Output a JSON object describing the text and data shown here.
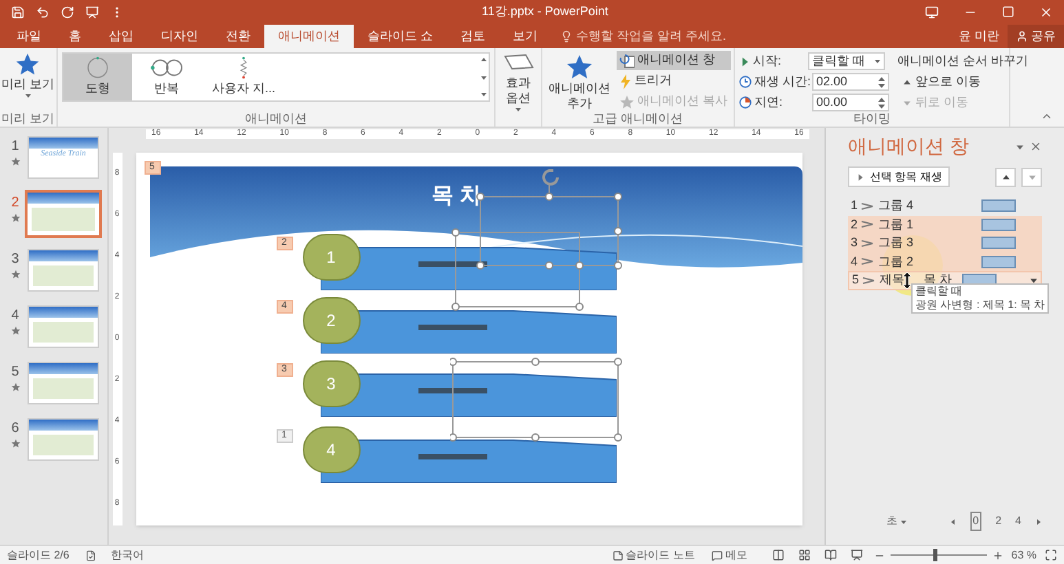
{
  "window": {
    "title": "11강.pptx - PowerPoint"
  },
  "tabs": [
    {
      "label": "파일",
      "selected": false
    },
    {
      "label": "홈",
      "selected": false
    },
    {
      "label": "삽입",
      "selected": false
    },
    {
      "label": "디자인",
      "selected": false
    },
    {
      "label": "전환",
      "selected": false
    },
    {
      "label": "애니메이션",
      "selected": true
    },
    {
      "label": "슬라이드 쇼",
      "selected": false
    },
    {
      "label": "검토",
      "selected": false
    },
    {
      "label": "보기",
      "selected": false
    }
  ],
  "tell_me": {
    "placeholder": "수행할 작업을 알려 주세요."
  },
  "account": {
    "user": "윤 미란",
    "share": "공유"
  },
  "ribbon": {
    "preview": {
      "button": "미리 보기",
      "group": "미리 보기"
    },
    "gallery": {
      "group": "애니메이션",
      "items": [
        {
          "kind": "shape",
          "label": "도형",
          "selected": true
        },
        {
          "kind": "loop",
          "label": "반복",
          "selected": false
        },
        {
          "kind": "custom",
          "label": "사용자 지...",
          "selected": false
        }
      ]
    },
    "effect_options": {
      "label": "효과 옵션"
    },
    "advanced": {
      "add": "애니메이션 추가",
      "group": "고급 애니메이션",
      "buttons": [
        {
          "kind": "pane",
          "label": "애니메이션 창",
          "selected": true,
          "disabled": false
        },
        {
          "kind": "trigger",
          "label": "트리거",
          "selected": false,
          "disabled": false
        },
        {
          "kind": "painter",
          "label": "애니메이션 복사",
          "selected": false,
          "disabled": true
        }
      ]
    },
    "timing": {
      "group": "타이밍",
      "start": {
        "label": "시작:",
        "value": "클릭할 때"
      },
      "duration": {
        "label": "재생 시간:",
        "value": "02.00"
      },
      "delay": {
        "label": "지연:",
        "value": "00.00"
      },
      "reorder": {
        "title": "애니메이션 순서 바꾸기",
        "earlier": {
          "label": "앞으로 이동",
          "disabled": false
        },
        "later": {
          "label": "뒤로 이동",
          "disabled": true
        }
      }
    }
  },
  "slides": [
    {
      "number": "1",
      "selected": false,
      "title": "Seaside Train"
    },
    {
      "number": "2",
      "selected": true
    },
    {
      "number": "3",
      "selected": false
    },
    {
      "number": "4",
      "selected": false
    },
    {
      "number": "5",
      "selected": false
    },
    {
      "number": "6",
      "selected": false
    }
  ],
  "rulers": {
    "horizontal": [
      "16",
      "14",
      "12",
      "10",
      "8",
      "6",
      "4",
      "2",
      "0",
      "2",
      "4",
      "6",
      "8",
      "10",
      "12",
      "14",
      "16"
    ],
    "vertical": [
      "8",
      "6",
      "4",
      "2",
      "0",
      "2",
      "4",
      "6",
      "8"
    ]
  },
  "slide": {
    "title": "목 차",
    "title_tag": {
      "label": "5",
      "selected": true
    },
    "items": [
      {
        "number": "1",
        "tag": {
          "label": "2",
          "selected": true
        }
      },
      {
        "number": "2",
        "tag": {
          "label": "4",
          "selected": true
        }
      },
      {
        "number": "3",
        "tag": {
          "label": "3",
          "selected": true
        }
      },
      {
        "number": "4",
        "tag": {
          "label": "1",
          "selected": false
        }
      }
    ]
  },
  "pane": {
    "title": "애니메이션 창",
    "play": "선택 항목 재생",
    "items": [
      {
        "number": "1",
        "name": "그룹 4",
        "selected": false
      },
      {
        "number": "2",
        "name": "그룹 1",
        "selected": true
      },
      {
        "number": "3",
        "name": "그룹 3",
        "selected": true
      },
      {
        "number": "4",
        "name": "그룹 2",
        "selected": true
      },
      {
        "number": "5",
        "name": "제목",
        "name_tail": "목 차",
        "selected": true
      }
    ],
    "tooltip": [
      "클릭할 때",
      "광원 사변형 : 제목 1: 목 차"
    ],
    "units": "초",
    "timeline": [
      "0",
      "2",
      "4"
    ]
  },
  "status_bar": {
    "slide": "슬라이드 2/6",
    "language": "한국어",
    "notes": "슬라이드 노트",
    "comments": "메모",
    "zoom": {
      "level": 0.45,
      "reading": "63 %"
    }
  }
}
